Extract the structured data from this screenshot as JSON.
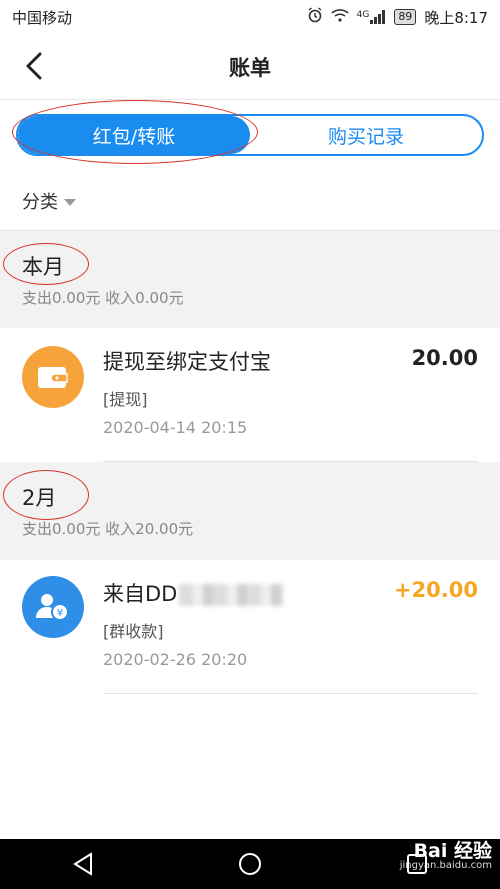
{
  "status_bar": {
    "carrier": "中国移动",
    "network": "4G",
    "battery": "89",
    "time": "晚上8:17"
  },
  "header": {
    "title": "账单"
  },
  "tabs": [
    {
      "label": "红包/转账",
      "active": true
    },
    {
      "label": "购买记录",
      "active": false
    }
  ],
  "filter": {
    "label": "分类"
  },
  "sections": [
    {
      "month": "本月",
      "summary": "支出0.00元 收入0.00元",
      "records": [
        {
          "title": "提现至绑定支付宝",
          "type": "[提现]",
          "time": "2020-04-14 20:15",
          "amount": "20.00",
          "icon": "wallet-icon",
          "icon_color": "#f5a33a",
          "amount_color": "#222222"
        }
      ]
    },
    {
      "month": "2月",
      "summary": "支出0.00元 收入20.00元",
      "records": [
        {
          "title": "来自DD",
          "type": "[群收款]",
          "time": "2020-02-26 20:20",
          "amount": "+20.00",
          "icon": "group-payment-icon",
          "icon_color": "#2f8ee8",
          "amount_color": "#f5a623"
        }
      ]
    }
  ],
  "watermark": {
    "brand": "Bai 经验",
    "url": "jingyan.baidu.com"
  },
  "colors": {
    "accent": "#1a8cf0",
    "annotation": "#d9342b"
  }
}
